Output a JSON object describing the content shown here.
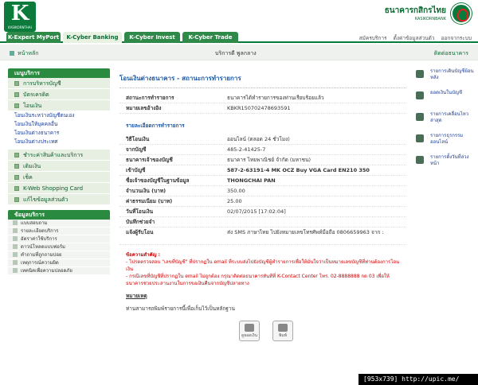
{
  "header": {
    "logo_text": "K",
    "logo_sub": "KASIKORNTHAI",
    "bank_th": "ธนาคารกสิกรไทย",
    "bank_en": "KASIKORNBANK"
  },
  "tabs": [
    {
      "label": "K-Expert MyPort"
    },
    {
      "label": "K-Cyber Banking"
    },
    {
      "label": "K-Cyber Invest"
    },
    {
      "label": "K-Cyber Trade"
    }
  ],
  "toplinks": {
    "apply": "สมัครบริการ",
    "settings": "ตั้งค่าข้อมูลส่วนตัว",
    "logout": "ออกจากระบบ"
  },
  "subbar": {
    "home": "หน้าหลัก",
    "user": "บริการดี พูลกลาง",
    "contact": "ติดต่อธนาคาร"
  },
  "sidebar": {
    "menu_title": "เมนูบริการ",
    "items": [
      {
        "label": "การบริหารบัญชี"
      },
      {
        "label": "บัตรเครดิต"
      },
      {
        "label": "โอนเงิน"
      }
    ],
    "transfer_sub": [
      {
        "label": "โอนเงินระหว่างบัญชีตนเอง"
      },
      {
        "label": "โอนเงินให้บุคคลอื่น"
      },
      {
        "label": "โอนเงินต่างธนาคาร"
      },
      {
        "label": "โอนเงินต่างประเทศ"
      }
    ],
    "items2": [
      {
        "label": "ชำระค่าสินค้าและบริการ"
      },
      {
        "label": "เติมเงิน"
      },
      {
        "label": "เช็ค"
      },
      {
        "label": "K-Web Shopping Card"
      },
      {
        "label": "แก้ไขข้อมูลส่วนตัว"
      }
    ],
    "svc_title": "ข้อมูลบริการ",
    "services": [
      {
        "label": "แบบสอบถาม"
      },
      {
        "label": "รายละเอียดบริการ"
      },
      {
        "label": "อัตราค่าใช้บริการ"
      },
      {
        "label": "ดาวน์โหลดแบบฟอร์ม"
      },
      {
        "label": "คำถามที่ถูกถามบ่อย"
      },
      {
        "label": "เหตุการณ์ความผิด"
      },
      {
        "label": "เทคนิคเพื่อความปลอดภัย"
      }
    ]
  },
  "main": {
    "title": "โอนเงินต่างธนาคาร - สถานะการทำรายการ",
    "status_label": "สถานะการทำรายการ",
    "status_value": "ธนาคารได้ทำรายการของท่านเรียบร้อยแล้ว",
    "ref_label": "หมายเลขอ้างอิง",
    "ref_value": "KBKR150702478693591",
    "details_title": "รายละเอียดการทำรายการ",
    "rows": [
      {
        "label": "วิธีโอนเงิน",
        "value": "ออนไลน์ (ตลอด 24 ชั่วโมง)",
        "bold": false
      },
      {
        "label": "จากบัญชี",
        "value": "485-2-41425-7",
        "bold": false
      },
      {
        "label": "ธนาคารเจ้าของบัญชี",
        "value": "ธนาคาร ไทยพาณิชย์ จำกัด (มหาชน)",
        "bold": false
      },
      {
        "label": "เข้าบัญชี",
        "value": "587-2-63191-4 MK OCZ Buy VGA Card EN210 350",
        "bold": true
      },
      {
        "label": "ชื่อเจ้าของบัญชีในฐานข้อมูล",
        "value": "THONGCHAI PAN",
        "bold": true
      },
      {
        "label": "จำนวนเงิน (บาท)",
        "value": "350.00",
        "bold": false
      },
      {
        "label": "ค่าธรรมเนียม (บาท)",
        "value": "25.00",
        "bold": false
      },
      {
        "label": "วันที่โอนเงิน",
        "value": "02/07/2015 [17:02:04]",
        "bold": false
      },
      {
        "label": "บันทึกช่วยจำ",
        "value": "",
        "bold": false
      },
      {
        "label": "แจ้งผู้รับโอน",
        "value": "ส่ง SMS ภาษาไทย ไปยังหมายเลขโทรศัพท์มือถือ 0806659963 จาก :",
        "bold": false
      }
    ],
    "note_head": "ข้อความสำคัญ :",
    "note_1": "- โปรดตรวจสอบ \"เลขที่บัญชี\" ที่ปรากฏใน email ที่ระบบส่งไปยังบัญชีผู้ทำรายการเพื่อให้มั่นใจว่าเป็นหมายเลขบัญชีที่ท่านต้องการโอนเงิน",
    "note_2": "- กรณีเลขที่บัญชีที่ปรากฏใน email ไม่ถูกต้อง กรุณาติดต่อธนาคารทันทีที่ K-Contact Center โทร. 02-8888888 กด 03 เพื่อให้ธนาคารช่วยประสานงานในการขอเงินคืนจากบัญชีปลายทาง",
    "remark_head": "หมายเหตุ",
    "remark": "ท่านสามารถพิมพ์รายการนี้เพื่อเก็บไว้เป็นหลักฐาน",
    "btn_save": "ดูยอดเงิน",
    "btn_print": "พิมพ์"
  },
  "rside": [
    {
      "label": "รายการเดินบัญชีย้อนหลัง"
    },
    {
      "label": "ยอดเงินในบัญชี"
    },
    {
      "label": "รายการเคลื่อนไหวล่าสุด"
    },
    {
      "label": "รายการธุรกรรมออนไลน์"
    },
    {
      "label": "รายการตั้งวันที่ล่วงหน้า"
    }
  ],
  "watermark": "[953x739] http://upic.me/"
}
